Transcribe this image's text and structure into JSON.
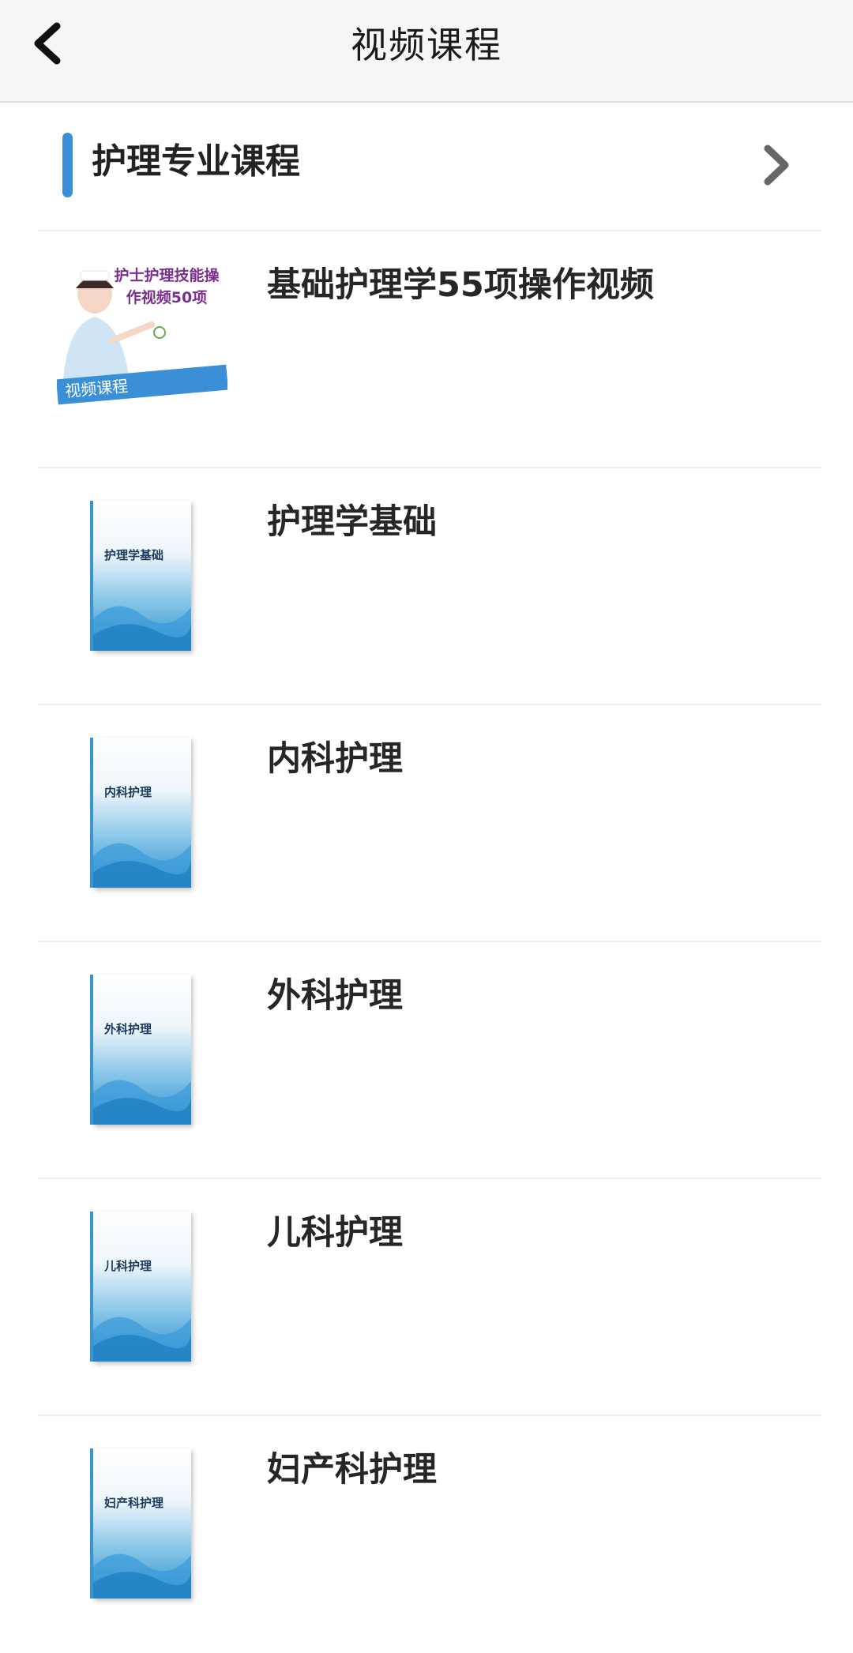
{
  "header": {
    "title": "视频课程",
    "back_icon": "chevron-left-icon"
  },
  "section": {
    "title": "护理专业课程",
    "more_icon": "chevron-right-icon",
    "accent_color": "#3a8fd6"
  },
  "courses": [
    {
      "title": "基础护理学55项操作视频",
      "cover": {
        "style": "promo",
        "title_line1": "护士护理技能操",
        "title_line2": "作视频50项",
        "banner": "视频课程"
      }
    },
    {
      "title": "护理学基础",
      "cover": {
        "style": "book",
        "label": "护理学基础"
      }
    },
    {
      "title": "内科护理",
      "cover": {
        "style": "book",
        "label": "内科护理"
      }
    },
    {
      "title": "外科护理",
      "cover": {
        "style": "book",
        "label": "外科护理"
      }
    },
    {
      "title": "儿科护理",
      "cover": {
        "style": "book",
        "label": "儿科护理"
      }
    },
    {
      "title": "妇产科护理",
      "cover": {
        "style": "book",
        "label": "妇产科护理"
      }
    }
  ]
}
